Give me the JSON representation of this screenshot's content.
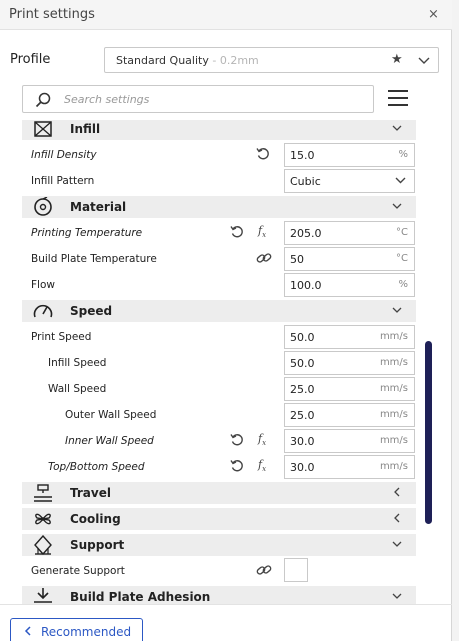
{
  "window": {
    "title": "Print settings",
    "close_glyph": "×"
  },
  "profile": {
    "label": "Profile",
    "name": "Standard Quality",
    "sub": " - 0.2mm"
  },
  "search": {
    "placeholder": "Search settings"
  },
  "categories": {
    "infill": "Infill",
    "material": "Material",
    "speed": "Speed",
    "travel": "Travel",
    "cooling": "Cooling",
    "support": "Support",
    "adhesion": "Build Plate Adhesion"
  },
  "settings": {
    "infill_density": {
      "label": "Infill Density",
      "value": "15.0",
      "unit": "%"
    },
    "infill_pattern": {
      "label": "Infill Pattern",
      "value": "Cubic"
    },
    "printing_temperature": {
      "label": "Printing Temperature",
      "value": "205.0",
      "unit": "°C"
    },
    "build_plate_temperature": {
      "label": "Build Plate Temperature",
      "value": "50",
      "unit": "°C"
    },
    "flow": {
      "label": "Flow",
      "value": "100.0",
      "unit": "%"
    },
    "print_speed": {
      "label": "Print Speed",
      "value": "50.0",
      "unit": "mm/s"
    },
    "infill_speed": {
      "label": "Infill Speed",
      "value": "50.0",
      "unit": "mm/s"
    },
    "wall_speed": {
      "label": "Wall Speed",
      "value": "25.0",
      "unit": "mm/s"
    },
    "outer_wall_speed": {
      "label": "Outer Wall Speed",
      "value": "25.0",
      "unit": "mm/s"
    },
    "inner_wall_speed": {
      "label": "Inner Wall Speed",
      "value": "30.0",
      "unit": "mm/s"
    },
    "top_bottom_speed": {
      "label": "Top/Bottom Speed",
      "value": "30.0",
      "unit": "mm/s"
    },
    "generate_support": {
      "label": "Generate Support"
    }
  },
  "icons": {
    "fx": "f",
    "fx_sub": "x"
  },
  "footer": {
    "recommended_label": "Recommended"
  },
  "colors": {
    "accent": "#2c58c4",
    "scrollbar": "#1e2057",
    "category_bg": "#ededed"
  }
}
